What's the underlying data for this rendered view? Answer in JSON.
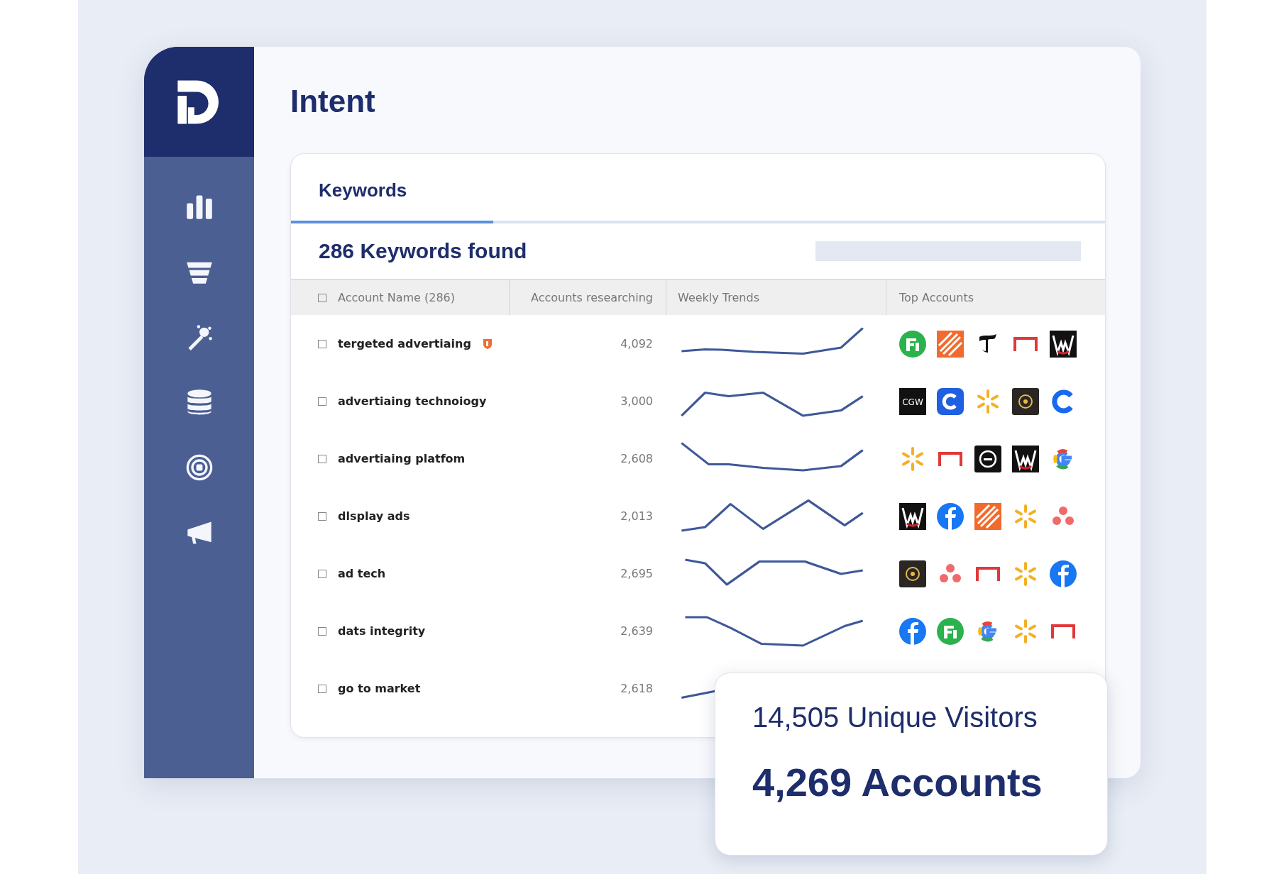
{
  "page": {
    "title": "Intent"
  },
  "panel": {
    "tab": "Keywords",
    "heading": "286 Keywords found",
    "table": {
      "header_checked": false,
      "columns": [
        "Account Name (286)",
        "Accounts researching",
        "Weekly Trends",
        "Top Accounts"
      ],
      "rows": [
        {
          "keyword": "tergeted advertiaing",
          "checked": false,
          "flagged": true,
          "researching": "4,092",
          "logos": [
            {
              "kind": "fi"
            },
            {
              "kind": "stripes"
            },
            {
              "kind": "gothic"
            },
            {
              "kind": "bracket"
            },
            {
              "kind": "w"
            }
          ]
        },
        {
          "keyword": "advertiaing technoiogy",
          "checked": false,
          "flagged": false,
          "researching": "3,000",
          "logos": [
            {
              "kind": "tile",
              "label": "CGW"
            },
            {
              "kind": "c-square"
            },
            {
              "kind": "spark"
            },
            {
              "kind": "dark-circle"
            },
            {
              "kind": "c"
            }
          ]
        },
        {
          "keyword": "advertiaing platfom",
          "checked": false,
          "flagged": false,
          "researching": "2,608",
          "logos": [
            {
              "kind": "spark"
            },
            {
              "kind": "bracket"
            },
            {
              "kind": "ring"
            },
            {
              "kind": "w"
            },
            {
              "kind": "g"
            }
          ]
        },
        {
          "keyword": "dlsplay ads",
          "checked": false,
          "flagged": false,
          "researching": "2,013",
          "logos": [
            {
              "kind": "w"
            },
            {
              "kind": "f"
            },
            {
              "kind": "stripes"
            },
            {
              "kind": "spark"
            },
            {
              "kind": "dots"
            }
          ]
        },
        {
          "keyword": "ad tech",
          "checked": false,
          "flagged": false,
          "researching": "2,695",
          "logos": [
            {
              "kind": "dark-circle"
            },
            {
              "kind": "dots"
            },
            {
              "kind": "bracket"
            },
            {
              "kind": "spark"
            },
            {
              "kind": "f"
            }
          ]
        },
        {
          "keyword": "dats integrity",
          "checked": false,
          "flagged": false,
          "researching": "2,639",
          "logos": [
            {
              "kind": "f"
            },
            {
              "kind": "fi"
            },
            {
              "kind": "g"
            },
            {
              "kind": "spark"
            },
            {
              "kind": "bracket"
            }
          ]
        },
        {
          "keyword": "go to market",
          "checked": false,
          "flagged": false,
          "researching": "2,618",
          "logos": []
        }
      ]
    }
  },
  "popup": {
    "visitors": "14,505 Unique Visitors",
    "accounts": "4,269 Accounts"
  }
}
